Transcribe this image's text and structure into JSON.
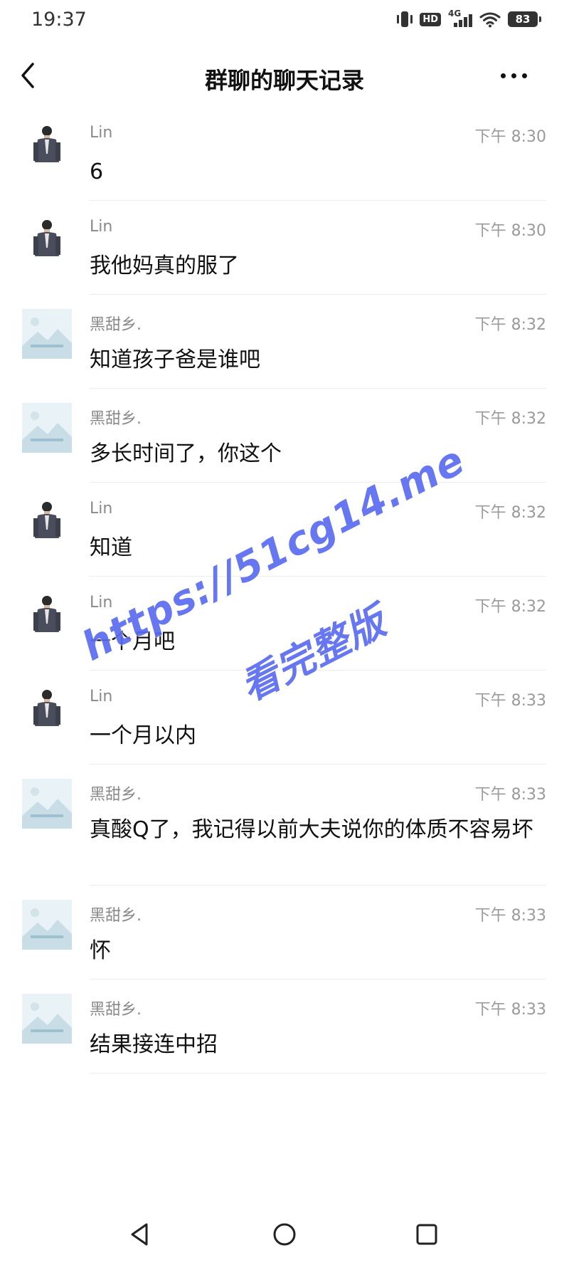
{
  "status_bar": {
    "time": "19:37",
    "hd_label": "HD",
    "network_label": "4G",
    "battery": "83",
    "icons": [
      "vibrate-icon",
      "hd-icon",
      "signal-icon",
      "wifi-icon",
      "battery-icon"
    ]
  },
  "header": {
    "title": "群聊的聊天记录",
    "back_icon": "chevron-left-icon",
    "more_icon": "more-horizontal-icon"
  },
  "messages": [
    {
      "sender": "Lin",
      "time": "下午 8:30",
      "text": "6",
      "avatar": "person-photo"
    },
    {
      "sender": "Lin",
      "time": "下午 8:30",
      "text": "我他妈真的服了",
      "avatar": "person-photo"
    },
    {
      "sender": "黑甜乡.",
      "time": "下午 8:32",
      "text": "知道孩子爸是谁吧",
      "avatar": "landscape-placeholder"
    },
    {
      "sender": "黑甜乡.",
      "time": "下午 8:32",
      "text": "多长时间了，你这个",
      "avatar": "landscape-placeholder"
    },
    {
      "sender": "Lin",
      "time": "下午 8:32",
      "text": "知道",
      "avatar": "person-photo"
    },
    {
      "sender": "Lin",
      "time": "下午 8:32",
      "text": "一个月吧",
      "avatar": "person-photo"
    },
    {
      "sender": "Lin",
      "time": "下午 8:33",
      "text": "一个月以内",
      "avatar": "person-photo"
    },
    {
      "sender": "黑甜乡.",
      "time": "下午 8:33",
      "text": "真酸Q了，我记得以前大夫说你的体质不容易坏",
      "avatar": "landscape-placeholder"
    },
    {
      "sender": "黑甜乡.",
      "time": "下午 8:33",
      "text": "怀",
      "avatar": "landscape-placeholder"
    },
    {
      "sender": "黑甜乡.",
      "time": "下午 8:33",
      "text": "结果接连中招",
      "avatar": "landscape-placeholder"
    }
  ],
  "watermark": {
    "url": "https://51cg14.me",
    "caption": "看完整版"
  },
  "nav_bar": {
    "icons": [
      "back-triangle-icon",
      "home-circle-icon",
      "recents-square-icon"
    ]
  },
  "colors": {
    "text": "#111111",
    "meta": "#8a8a8a",
    "divider": "#ececec",
    "watermark": "#5a6cf0"
  }
}
